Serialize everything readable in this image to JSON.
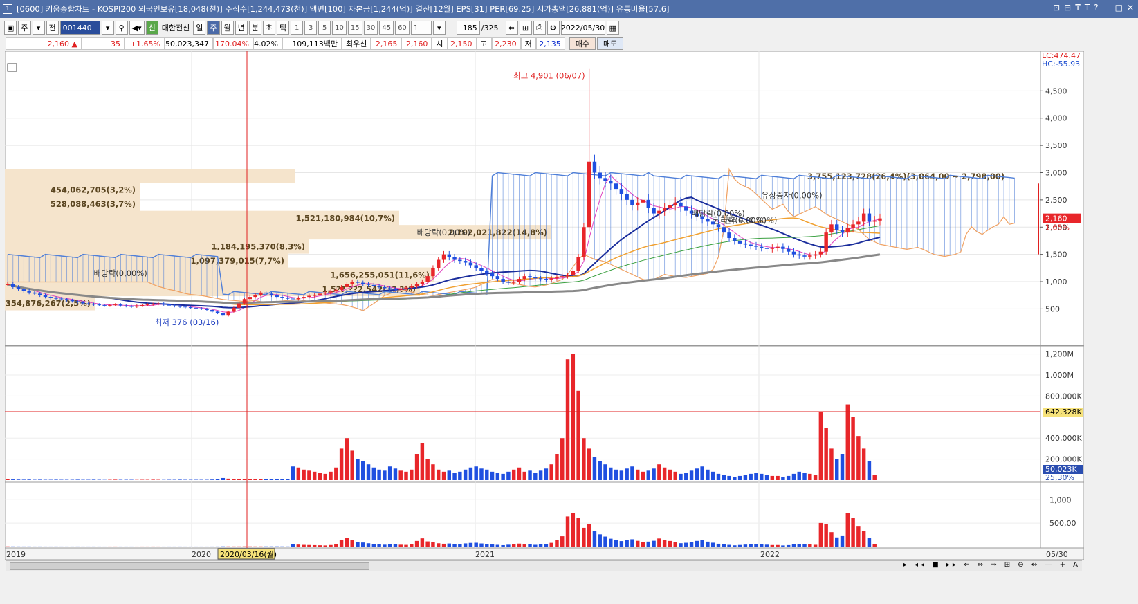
{
  "window": {
    "app_icon": "1",
    "title": "[0600] 키움종합차트 - KOSPI200 외국인보유[18,048(천)] 주식수[1,244,473(천)] 액면[100] 자본금[1,244(억)] 결산[12월] EPS[31] PER[69.25] 시가총액[26,881(억)] 유통비율[57.6]",
    "controls": [
      "⊡",
      "⊟",
      "₸",
      "T",
      "?",
      "—",
      "□",
      "✕"
    ]
  },
  "toolbar": {
    "period_kind": "주",
    "prev_label": "전",
    "stock_code": "001440",
    "stock_name": "대한전선",
    "new_badge": "신",
    "timeframes": [
      "일",
      "주",
      "월",
      "년",
      "분",
      "초",
      "틱"
    ],
    "selected_timeframe": "주",
    "intervals": [
      "1",
      "3",
      "5",
      "10",
      "15",
      "30",
      "45",
      "60"
    ],
    "unit_value": "1",
    "count": "185",
    "count_total": "/325",
    "date": "2022/05/30"
  },
  "quote": {
    "price": "2,160",
    "direction": "▲",
    "change": "35",
    "change_pct": "+1.65%",
    "volume": "50,023,347",
    "volume_ratio": "170.04%",
    "turnover": "4.02%",
    "amount": "109,113백만",
    "best_label": "최우선",
    "best_ask": "2,165",
    "best_bid": "2,160",
    "open_label": "시",
    "open": "2,150",
    "high_label": "고",
    "high": "2,230",
    "low_label": "저",
    "low": "2,135",
    "buy_button": "매수",
    "sell_button": "매도"
  },
  "chart_data": {
    "type": "candlestick",
    "price_axis_ticks": [
      "4,500",
      "4,000",
      "3,500",
      "3,000",
      "2,500",
      "2,000",
      "1,500",
      "1,000",
      "500"
    ],
    "top_right_labels": [
      "LC:474.47",
      "HC:-55.93"
    ],
    "current_price_label": "2,160",
    "current_change_label": "1.65%",
    "x_labels": [
      "2019",
      "2020",
      "2021",
      "2022"
    ],
    "crosshair_date_label": "2020/03/16(월)",
    "end_date_label": "05/30",
    "annotations": {
      "high": "최고 4,901 (06/07)",
      "low": "최저 376 (03/16)",
      "dividend_1": "배당락(0,00%)",
      "dividend_2": "배당락(0,00%)",
      "dividend_3": "배당락(0,00%)",
      "rights_1": "권리락(0,00%)",
      "rights_2": "권리락(0,00%)",
      "capital_increase": "유상증자(0,00%)"
    },
    "volume_profile": [
      {
        "label": "3,755,123,728(26,4%)(3,064,00 ~ 2,798,00)",
        "price_mid": 2930
      },
      {
        "label": "454,062,705(3,2%)",
        "price_mid": 2680
      },
      {
        "label": "528,088,463(3,7%)",
        "price_mid": 2420
      },
      {
        "label": "1,521,180,984(10,7%)",
        "price_mid": 2160
      },
      {
        "label": "2,102,021,822(14,8%)",
        "price_mid": 1900
      },
      {
        "label": "1,184,195,370(8,3%)",
        "price_mid": 1640
      },
      {
        "label": "1,097,379,015(7,7%)",
        "price_mid": 1380
      },
      {
        "label": "1,656,255,051(11,6%)",
        "price_mid": 1120
      },
      {
        "label": "1,5??,??2,542(1?,?%)",
        "price_mid": 860
      },
      {
        "label": "354,876,267(2,5%)",
        "price_mid": 600
      }
    ],
    "volume_axis_ticks": [
      "1,200M",
      "1,000M",
      "800,000K",
      "400,000K",
      "200,000K"
    ],
    "volume_marker_label": "642,328K",
    "volume_current_label": "50,023K",
    "volume_pct_label": "25,30%",
    "amount_axis_ticks": [
      "1,000",
      "500,00"
    ],
    "colors": {
      "up": "#e8262a",
      "down": "#1f4fe0",
      "ma_blue": "#1a2d9c",
      "ma_orange": "#f0a030",
      "ma_green": "#3aa040",
      "ma_pink": "#e040c0",
      "cloud": "#4f7fd8",
      "profile": "#f5e4cc"
    },
    "weekly_closes": [
      950,
      900,
      860,
      830,
      800,
      780,
      750,
      720,
      700,
      690,
      680,
      660,
      640,
      620,
      600,
      590,
      580,
      570,
      560,
      570,
      580,
      560,
      550,
      540,
      560,
      570,
      580,
      590,
      600,
      580,
      560,
      550,
      540,
      530,
      520,
      510,
      500,
      480,
      450,
      420,
      376,
      450,
      520,
      600,
      680,
      720,
      760,
      800,
      780,
      750,
      720,
      700,
      690,
      680,
      700,
      720,
      740,
      760,
      780,
      800,
      820,
      850,
      900,
      950,
      1000,
      980,
      960,
      940,
      920,
      900,
      880,
      860,
      850,
      870,
      890,
      920,
      960,
      1000,
      1100,
      1250,
      1400,
      1500,
      1450,
      1400,
      1380,
      1350,
      1300,
      1250,
      1200,
      1150,
      1100,
      1050,
      1000,
      980,
      1000,
      1050,
      1100,
      1080,
      1060,
      1050,
      1040,
      1060,
      1080,
      1100,
      1120,
      1200,
      1450,
      2000,
      3200,
      3000,
      2900,
      2850,
      2800,
      2700,
      2600,
      2500,
      2400,
      2450,
      2500,
      2350,
      2250,
      2300,
      2350,
      2400,
      2450,
      2380,
      2300,
      2250,
      2200,
      2150,
      2100,
      2050,
      2000,
      1900,
      1800,
      1750,
      1700,
      1680,
      1660,
      1640,
      1620,
      1600,
      1620,
      1640,
      1600,
      1550,
      1500,
      1480,
      1460,
      1480,
      1500,
      1550,
      1900,
      2050,
      1950,
      1900,
      1980,
      2050,
      2100,
      2250,
      2100,
      2120,
      2160
    ],
    "weekly_volumes_m": [
      8,
      6,
      5,
      4,
      5,
      3,
      4,
      3,
      3,
      4,
      3,
      3,
      3,
      4,
      3,
      3,
      4,
      3,
      2,
      3,
      4,
      3,
      3,
      3,
      2,
      3,
      3,
      4,
      3,
      2,
      3,
      3,
      4,
      3,
      3,
      3,
      3,
      3,
      5,
      8,
      20,
      14,
      10,
      9,
      12,
      10,
      8,
      8,
      9,
      10,
      12,
      10,
      8,
      130,
      120,
      100,
      90,
      80,
      70,
      60,
      80,
      120,
      300,
      400,
      280,
      200,
      180,
      150,
      120,
      100,
      90,
      130,
      110,
      90,
      80,
      100,
      250,
      350,
      200,
      150,
      100,
      80,
      90,
      70,
      80,
      100,
      120,
      130,
      110,
      100,
      80,
      70,
      60,
      80,
      100,
      120,
      80,
      90,
      70,
      90,
      110,
      150,
      250,
      400,
      1150,
      1200,
      850,
      400,
      300,
      220,
      180,
      150,
      120,
      100,
      90,
      110,
      130,
      100,
      80,
      90,
      110,
      150,
      120,
      100,
      80,
      60,
      70,
      90,
      110,
      130,
      100,
      80,
      60,
      50,
      40,
      30,
      40,
      50,
      60,
      70,
      60,
      50,
      40,
      40,
      30,
      40,
      60,
      80,
      70,
      60,
      50,
      650,
      500,
      300,
      200,
      250,
      720,
      600,
      420,
      300,
      180,
      50
    ]
  }
}
